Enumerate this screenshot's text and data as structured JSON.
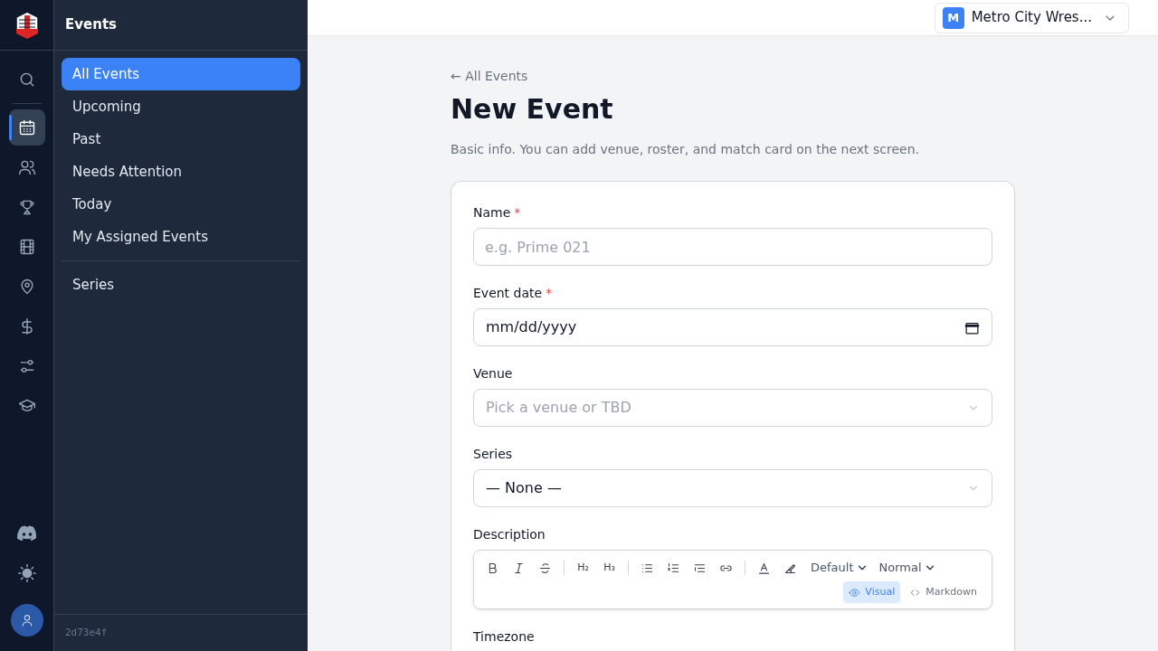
{
  "rail": {
    "items": [
      {
        "selected": false
      },
      {
        "selected": true
      },
      {
        "selected": false
      },
      {
        "selected": false
      },
      {
        "selected": false
      },
      {
        "selected": false
      },
      {
        "selected": false
      },
      {
        "selected": false
      },
      {
        "selected": false
      }
    ]
  },
  "sidebar": {
    "title": "Events",
    "items": [
      {
        "label": "All Events",
        "selected": true
      },
      {
        "label": "Upcoming",
        "selected": false
      },
      {
        "label": "Past",
        "selected": false
      },
      {
        "label": "Needs Attention",
        "selected": false
      },
      {
        "label": "Today",
        "selected": false
      },
      {
        "label": "My Assigned Events",
        "selected": false
      }
    ],
    "secondary_items": [
      {
        "label": "Series",
        "selected": false
      }
    ],
    "version": "2d73e4f"
  },
  "header": {
    "org_initial": "M",
    "org_name": "Metro City Wres..."
  },
  "back_link": "← All Events",
  "title": "New Event",
  "subtitle": "Basic info. You can add venue, roster, and match card on the next screen.",
  "fields": [
    {
      "kind": "text",
      "label": "Name",
      "required_mark": "*",
      "placeholder": "e.g. Prime 021"
    },
    {
      "kind": "date",
      "label": "Event date",
      "required_mark": "*",
      "placeholder": "mm/dd/yyyy"
    },
    {
      "kind": "select",
      "label": "Venue",
      "placeholder": "Pick a venue or TBD"
    },
    {
      "kind": "select",
      "label": "Series",
      "value": "— None —"
    },
    {
      "kind": "editor",
      "label": "Description",
      "toolbar": {
        "headings": [
          "H₂",
          "H₃"
        ],
        "dropdowns": [
          "Default",
          "Normal"
        ],
        "modes": [
          {
            "label": "Visual",
            "selected": true
          },
          {
            "label": "Markdown",
            "selected": false
          }
        ]
      }
    },
    {
      "kind": "cut",
      "label": "Timezone"
    }
  ]
}
